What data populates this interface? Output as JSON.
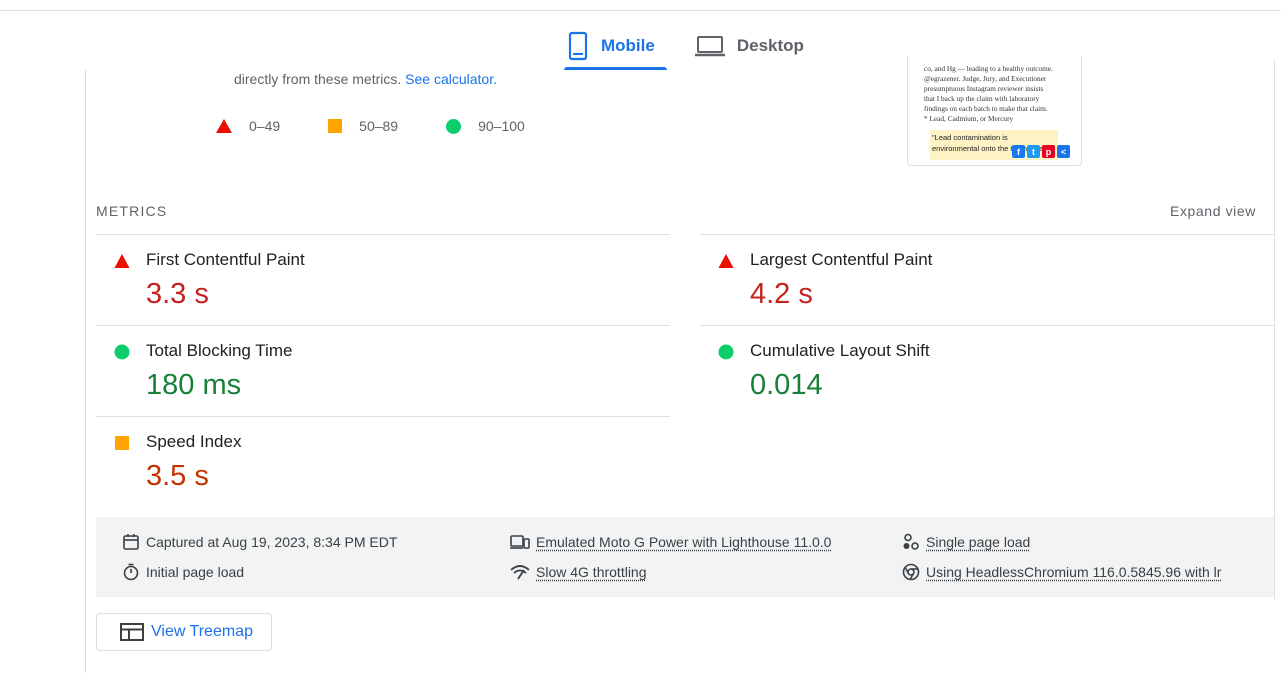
{
  "tabs": [
    {
      "label": "Mobile",
      "icon": "smartphone-icon",
      "active": true
    },
    {
      "label": "Desktop",
      "icon": "laptop-icon",
      "active": false
    }
  ],
  "calculator": {
    "text": "directly from these metrics. ",
    "link": "See calculator."
  },
  "legend": {
    "fail": "0–49",
    "average": "50–89",
    "pass": "90–100"
  },
  "thumbnail": {
    "lines": [
      "co, and Hg — leading to a healthy outcome.",
      "@egrazener. Judge, Jury, and Executioner",
      "presumptuous Instagram reviewer insists",
      "that I back up the claim with laboratory",
      "findings on each batch to make that claim.",
      "* Lead, Cadmium, or Mercury"
    ],
    "quote": "\"Lead contamination is environmental onto the the nuts and ..."
  },
  "metrics_header": "METRICS",
  "expand_label": "Expand view",
  "metrics": [
    {
      "title": "First Contentful Paint",
      "value": "3.3 s",
      "status": "fail"
    },
    {
      "title": "Largest Contentful Paint",
      "value": "4.2 s",
      "status": "fail"
    },
    {
      "title": "Total Blocking Time",
      "value": "180 ms",
      "status": "pass"
    },
    {
      "title": "Cumulative Layout Shift",
      "value": "0.014",
      "status": "pass"
    },
    {
      "title": "Speed Index",
      "value": "3.5 s",
      "status": "average"
    }
  ],
  "info": {
    "captured": "Captured at Aug 19, 2023, 8:34 PM EDT",
    "initial_load": "Initial page load",
    "emulated": "Emulated Moto G Power with Lighthouse 11.0.0",
    "throttling": "Slow 4G throttling",
    "single_load": "Single page load",
    "browser": "Using HeadlessChromium 116.0.5845.96 with lr"
  },
  "treemap_label": "View Treemap",
  "colors": {
    "accent": "#1a73e8",
    "fail": "#eb0f00",
    "average": "#ffa400",
    "pass": "#0cce6b",
    "fail_text": "#c5221f",
    "pass_text": "#188038",
    "average_text": "#c33300"
  }
}
